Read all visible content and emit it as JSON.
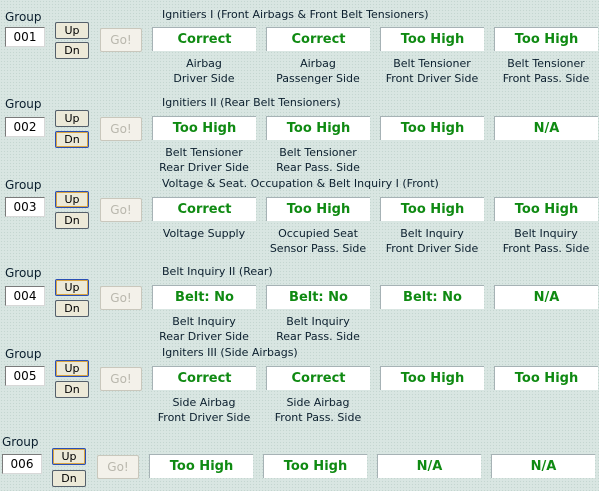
{
  "group_label": "Group",
  "up_label": "Up",
  "down_label": "Dn",
  "go_label": "Go!",
  "colors": {
    "value_text": "#0f8a12",
    "background": "#d9e6e2"
  },
  "groups": [
    {
      "number": "001",
      "title": "Ignitiers I (Front Airbags & Front Belt Tensioners)",
      "fields": [
        {
          "value": "Correct",
          "cap1": "Airbag",
          "cap2": "Driver Side"
        },
        {
          "value": "Correct",
          "cap1": "Airbag",
          "cap2": "Passenger Side"
        },
        {
          "value": "Too High",
          "cap1": "Belt Tensioner",
          "cap2": "Front Driver Side"
        },
        {
          "value": "Too High",
          "cap1": "Belt Tensioner",
          "cap2": "Front Pass. Side"
        }
      ]
    },
    {
      "number": "002",
      "title": "Ignitiers II (Rear Belt Tensioners)",
      "fields": [
        {
          "value": "Too High",
          "cap1": "Belt Tensioner",
          "cap2": "Rear Driver Side"
        },
        {
          "value": "Too High",
          "cap1": "Belt Tensioner",
          "cap2": "Rear Pass. Side"
        },
        {
          "value": "Too High",
          "cap1": "",
          "cap2": ""
        },
        {
          "value": "N/A",
          "cap1": "",
          "cap2": ""
        }
      ]
    },
    {
      "number": "003",
      "title": "Voltage & Seat. Occupation & Belt Inquiry I (Front)",
      "fields": [
        {
          "value": "Correct",
          "cap1": "Voltage Supply",
          "cap2": ""
        },
        {
          "value": "Too High",
          "cap1": "Occupied Seat",
          "cap2": "Sensor Pass. Side"
        },
        {
          "value": "Too High",
          "cap1": "Belt Inquiry",
          "cap2": "Front Driver Side"
        },
        {
          "value": "Too High",
          "cap1": "Belt Inquiry",
          "cap2": "Front Pass. Side"
        }
      ]
    },
    {
      "number": "004",
      "title": "Belt Inquiry II (Rear)",
      "fields": [
        {
          "value": "Belt: No",
          "cap1": "Belt Inquiry",
          "cap2": "Rear Driver Side"
        },
        {
          "value": "Belt: No",
          "cap1": "Belt Inquiry",
          "cap2": "Rear Pass. Side"
        },
        {
          "value": "Belt: No",
          "cap1": "",
          "cap2": ""
        },
        {
          "value": "N/A",
          "cap1": "",
          "cap2": ""
        }
      ]
    },
    {
      "number": "005",
      "title": "Igniters III (Side Airbags)",
      "fields": [
        {
          "value": "Correct",
          "cap1": "Side Airbag",
          "cap2": "Front Driver Side"
        },
        {
          "value": "Correct",
          "cap1": "Side Airbag",
          "cap2": "Front Pass. Side"
        },
        {
          "value": "Too High",
          "cap1": "",
          "cap2": ""
        },
        {
          "value": "Too High",
          "cap1": "",
          "cap2": ""
        }
      ]
    },
    {
      "number": "006",
      "title": "",
      "fields": [
        {
          "value": "Too High",
          "cap1": "",
          "cap2": ""
        },
        {
          "value": "Too High",
          "cap1": "",
          "cap2": ""
        },
        {
          "value": "N/A",
          "cap1": "",
          "cap2": ""
        },
        {
          "value": "N/A",
          "cap1": "",
          "cap2": ""
        }
      ]
    }
  ]
}
